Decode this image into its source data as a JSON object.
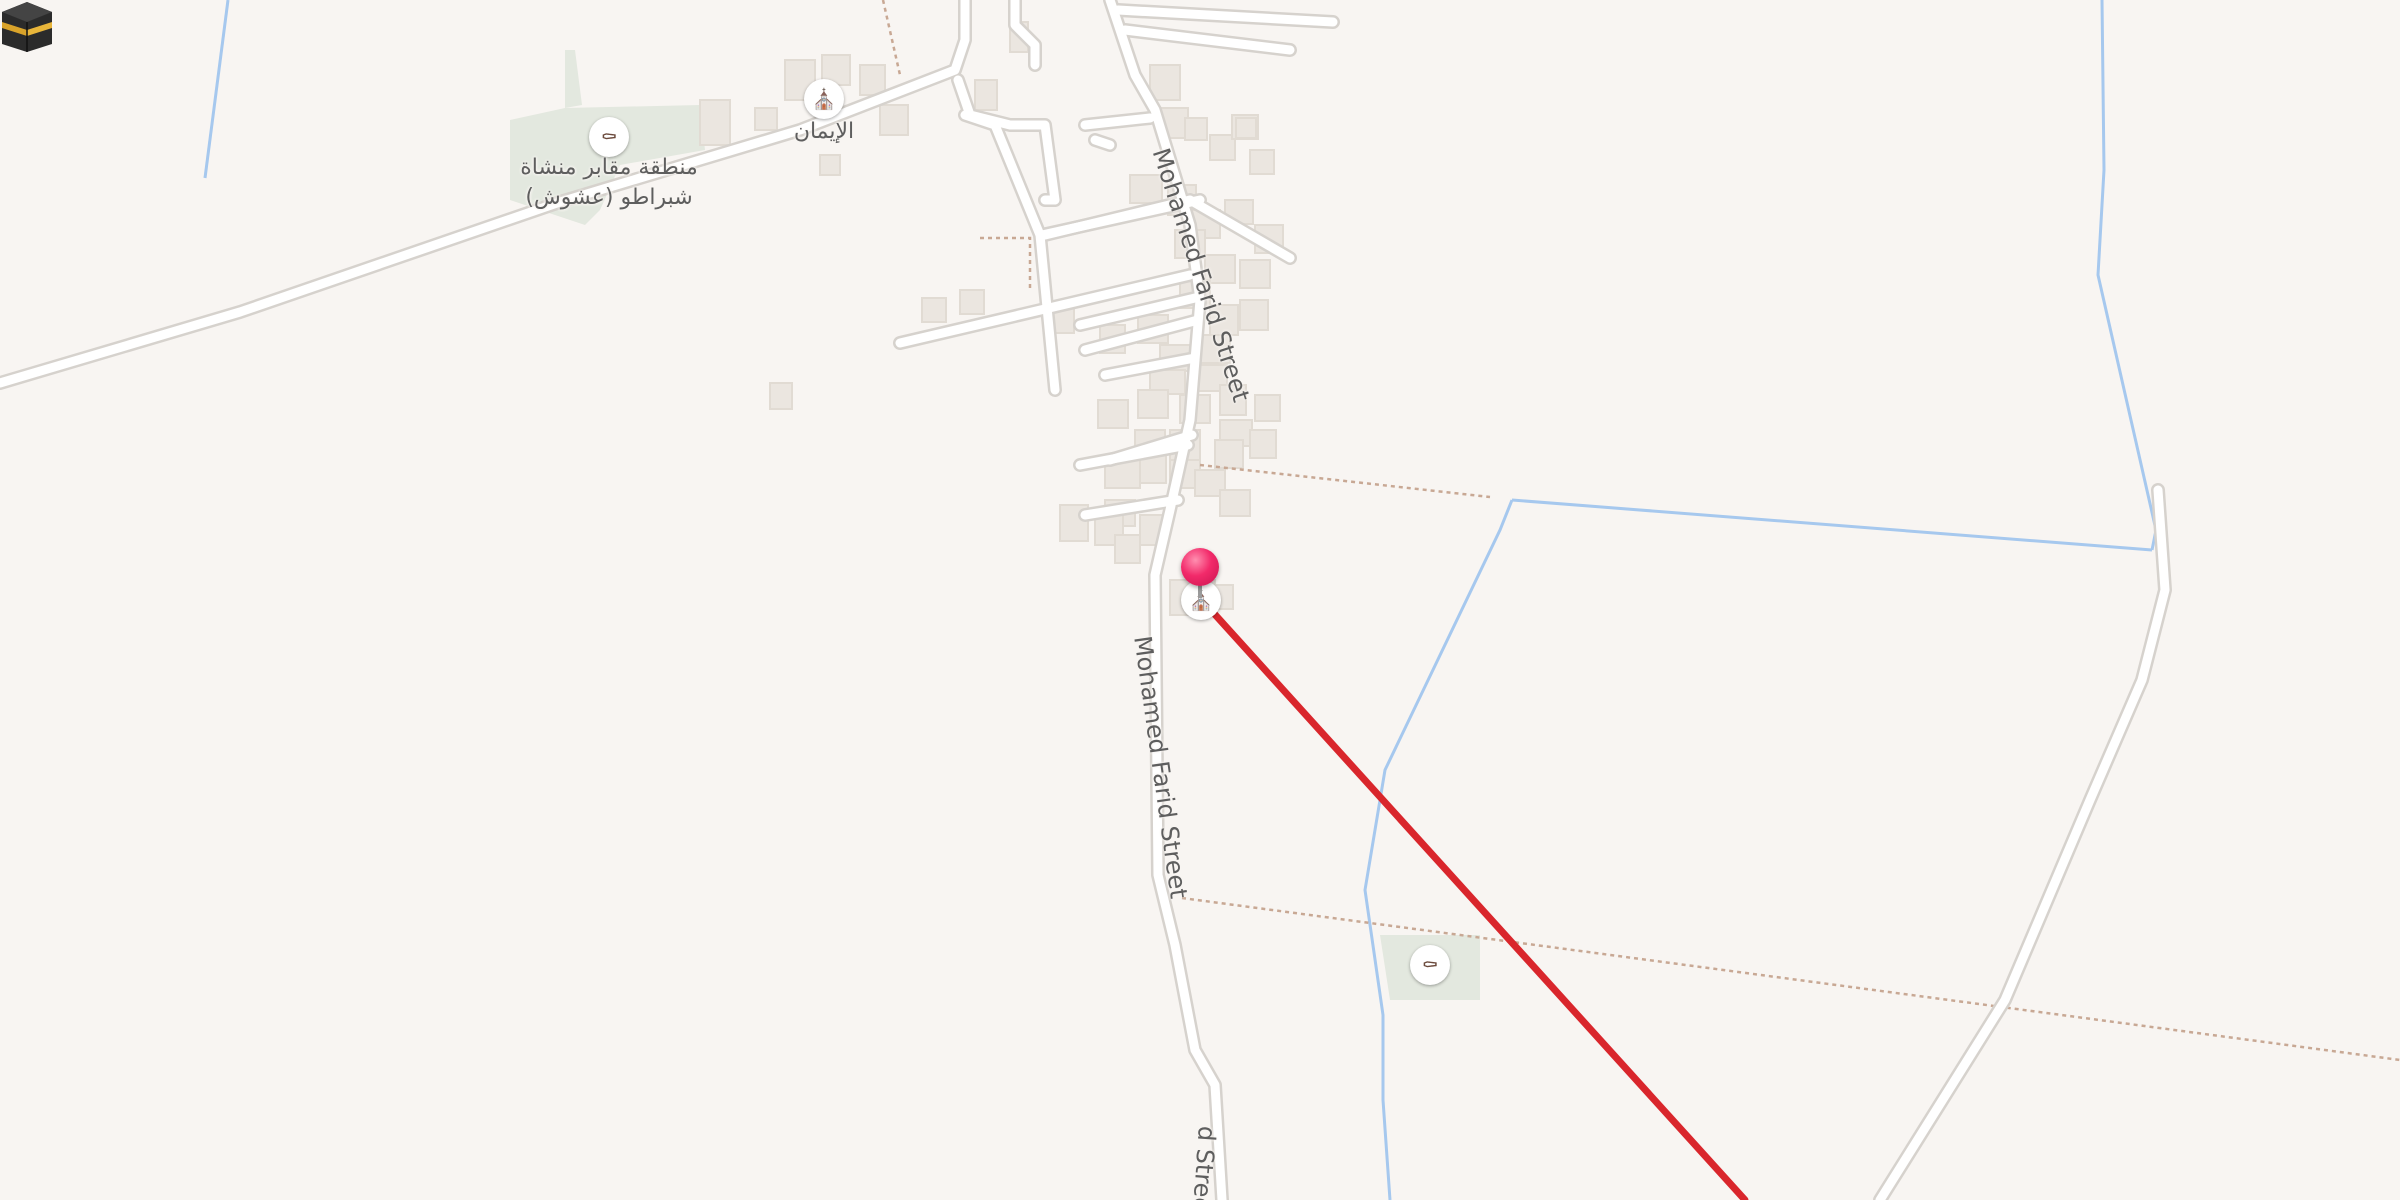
{
  "map": {
    "streets": {
      "mohamed_farid_upper": "Mohamed Farid Street",
      "mohamed_farid_middle": "Mohamed Farid Street",
      "mohamed_farid_lower": "d Street"
    },
    "pois": {
      "cemetery_label_line1": "منطقة مقابر منشاة",
      "cemetery_label_line2": "شبراطو (عشوش)",
      "mosque_label": "الإيمان"
    },
    "icons": {
      "cemetery_north": "cemetery-icon",
      "mosque_north": "mosque-icon",
      "mosque_selected": "mosque-icon",
      "cemetery_south": "cemetery-icon",
      "location_pin": "location-pin-icon",
      "kaaba": "kaaba-icon"
    },
    "colors": {
      "background": "#f8f5f2",
      "road": "#ffffff",
      "road_casing": "#d6d2cd",
      "water": "#a6c8ee",
      "qibla_line": "#d9262c",
      "pin": "#f22a6a",
      "boundary": "#c8a894",
      "green_area": "#e3e8df",
      "building": "#ebe6e0"
    }
  }
}
